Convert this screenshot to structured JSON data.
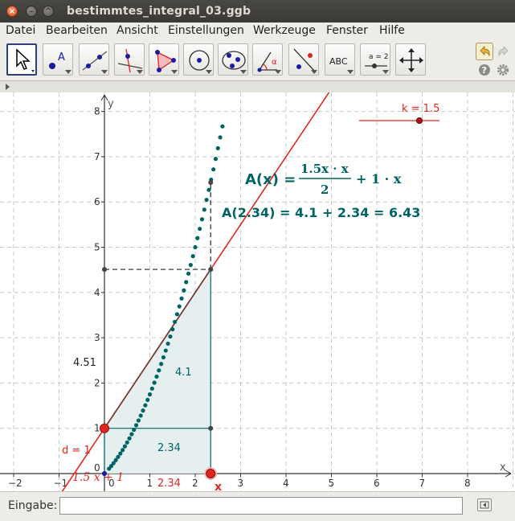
{
  "window": {
    "title": "bestimmtes_integral_03.ggb"
  },
  "menu": {
    "items": [
      "Datei",
      "Bearbeiten",
      "Ansicht",
      "Einstellungen",
      "Werkzeuge",
      "Fenster",
      "Hilfe"
    ]
  },
  "toolbar": {
    "tools": [
      {
        "icon": "move-pointer-icon",
        "selected": true
      },
      {
        "icon": "new-point-icon"
      },
      {
        "icon": "line-through-two-points-icon"
      },
      {
        "icon": "perpendicular-line-icon"
      },
      {
        "icon": "polygon-icon"
      },
      {
        "icon": "circle-center-point-icon"
      },
      {
        "icon": "conic-through-points-icon"
      },
      {
        "icon": "angle-icon"
      },
      {
        "icon": "reflect-about-line-icon"
      },
      {
        "icon": "text-icon",
        "label": "ABC"
      },
      {
        "icon": "slider-icon",
        "label": "a = 2"
      },
      {
        "icon": "move-graphics-view-icon"
      }
    ],
    "undo_icon": "undo-icon",
    "redo_icon": "redo-icon",
    "help_icon": "help-icon",
    "settings_icon": "gear-icon"
  },
  "graphics": {
    "axis_labels": {
      "x": "x",
      "y": "y"
    },
    "x_ticks": [
      "−2",
      "−1",
      "0",
      "1",
      "2",
      "3",
      "4",
      "5",
      "6",
      "7",
      "8"
    ],
    "y_ticks": [
      "0",
      "1",
      "2",
      "3",
      "4",
      "5",
      "6",
      "7",
      "8"
    ],
    "slider_label": "k = 1.5",
    "slider_value": 1.5,
    "formula": {
      "lhs": "A(x) =",
      "numerator": "1.5x · x",
      "denominator": "2",
      "tail": "+ 1 · x"
    },
    "evaluation": "A(2.34) = 4.1 + 2.34 = 6.43",
    "triangle_area_label": "4.1",
    "rectangle_area_label": "2.34",
    "height_label": "4.51",
    "d_label": "d = 1",
    "line_label": "1.5 x + 1",
    "x_value_label": "2.34",
    "x_point_label": "x",
    "model": {
      "k": 1.5,
      "d": 1,
      "x": 2.34,
      "A": 6.43,
      "trace_x": [
        0.1,
        2.6
      ]
    }
  },
  "input_bar": {
    "label": "Eingabe:",
    "value": "",
    "placeholder": ""
  },
  "colors": {
    "line": "#e0271d",
    "teal": "#006464",
    "fill": "#e3edee",
    "point": "#e0271d",
    "accent": "#2d3f7a"
  }
}
